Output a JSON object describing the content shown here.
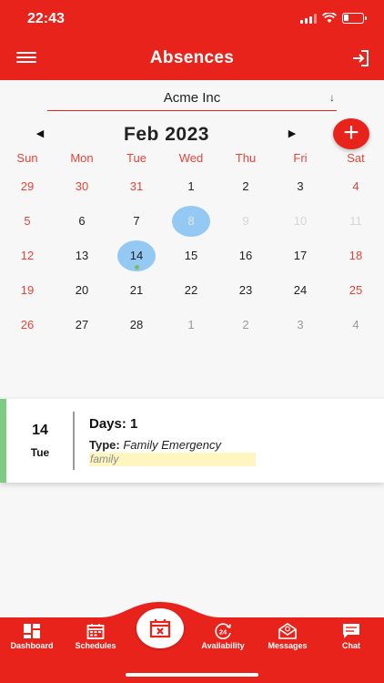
{
  "status_bar": {
    "time": "22:43"
  },
  "header": {
    "title": "Absences"
  },
  "company": {
    "selected": "Acme Inc"
  },
  "calendar": {
    "month_label": "Feb 2023",
    "weekdays": [
      "Sun",
      "Mon",
      "Tue",
      "Wed",
      "Thu",
      "Fri",
      "Sat"
    ],
    "weeks": [
      [
        "29",
        "30",
        "31",
        "1",
        "2",
        "3",
        "4"
      ],
      [
        "5",
        "6",
        "7",
        "8",
        "9",
        "10",
        "11"
      ],
      [
        "12",
        "13",
        "14",
        "15",
        "16",
        "17",
        "18"
      ],
      [
        "19",
        "20",
        "21",
        "22",
        "23",
        "24",
        "25"
      ],
      [
        "26",
        "27",
        "28",
        "1",
        "2",
        "3",
        "4"
      ]
    ]
  },
  "absence": {
    "day_number": "14",
    "day_name": "Tue",
    "days_label": "Days: 1",
    "type_label": "Type:",
    "type_value": "Family Emergency",
    "note": "family"
  },
  "nav": {
    "dashboard": "Dashboard",
    "schedules": "Schedules",
    "availability": "Availability",
    "messages": "Messages",
    "chat": "Chat"
  },
  "colors": {
    "primary": "#e8231b",
    "selected_day": "#94c9f3",
    "accent_green": "#7ecb86",
    "note_highlight": "#fff5bf"
  }
}
